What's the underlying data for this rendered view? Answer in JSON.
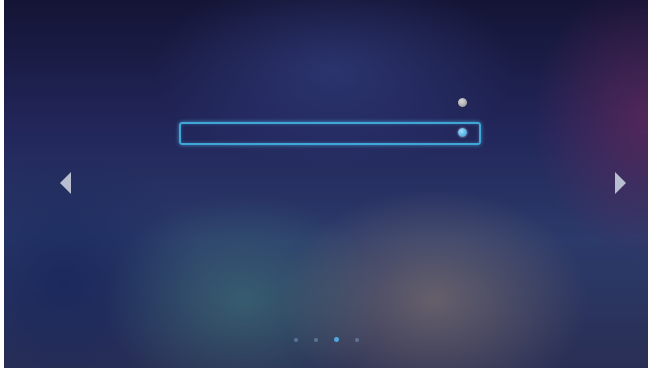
{
  "list": {
    "items": [
      {
        "label": "",
        "selected": false
      },
      {
        "label": "",
        "selected": true
      }
    ]
  },
  "navigation": {
    "prev_icon": "chevron-left-icon",
    "next_icon": "chevron-right-icon"
  },
  "pagination": {
    "total_pages": 4,
    "current_page": 3
  },
  "colors": {
    "accent": "#3fa6d6",
    "background_dark": "#1a1c45"
  }
}
